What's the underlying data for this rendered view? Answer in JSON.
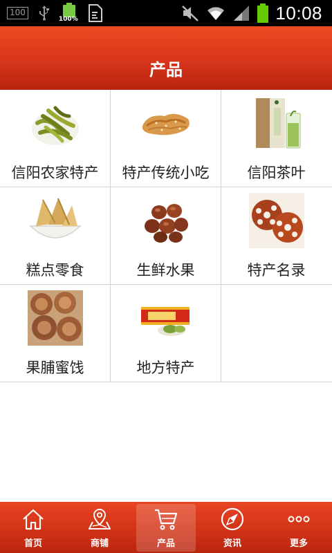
{
  "status_bar": {
    "notification_label": "100",
    "battery_small_label": "100%",
    "time": "10:08"
  },
  "header": {
    "title": "产品"
  },
  "products": [
    {
      "label": "信阳农家特产",
      "icon": "green-peppers-image"
    },
    {
      "label": "特产传统小吃",
      "icon": "crispy-snack-image"
    },
    {
      "label": "信阳茶叶",
      "icon": "tea-package-image"
    },
    {
      "label": "糕点零食",
      "icon": "pastry-bowl-image"
    },
    {
      "label": "生鲜水果",
      "icon": "chestnuts-image"
    },
    {
      "label": "特产名录",
      "icon": "lotus-root-image"
    },
    {
      "label": "果脯蜜饯",
      "icon": "dried-fruit-image"
    },
    {
      "label": "地方特产",
      "icon": "gift-box-image"
    }
  ],
  "tab_bar": {
    "items": [
      {
        "label": "首页",
        "icon": "home-icon"
      },
      {
        "label": "商铺",
        "icon": "map-pin-icon"
      },
      {
        "label": "产品",
        "icon": "shopping-cart-icon",
        "active": true
      },
      {
        "label": "资讯",
        "icon": "compass-icon"
      },
      {
        "label": "更多",
        "icon": "more-dots-icon"
      }
    ]
  },
  "colors": {
    "header_red": "#d6351a",
    "tab_red": "#d43417",
    "grid_border": "#d4d4d4",
    "battery_green": "#66cc00"
  }
}
